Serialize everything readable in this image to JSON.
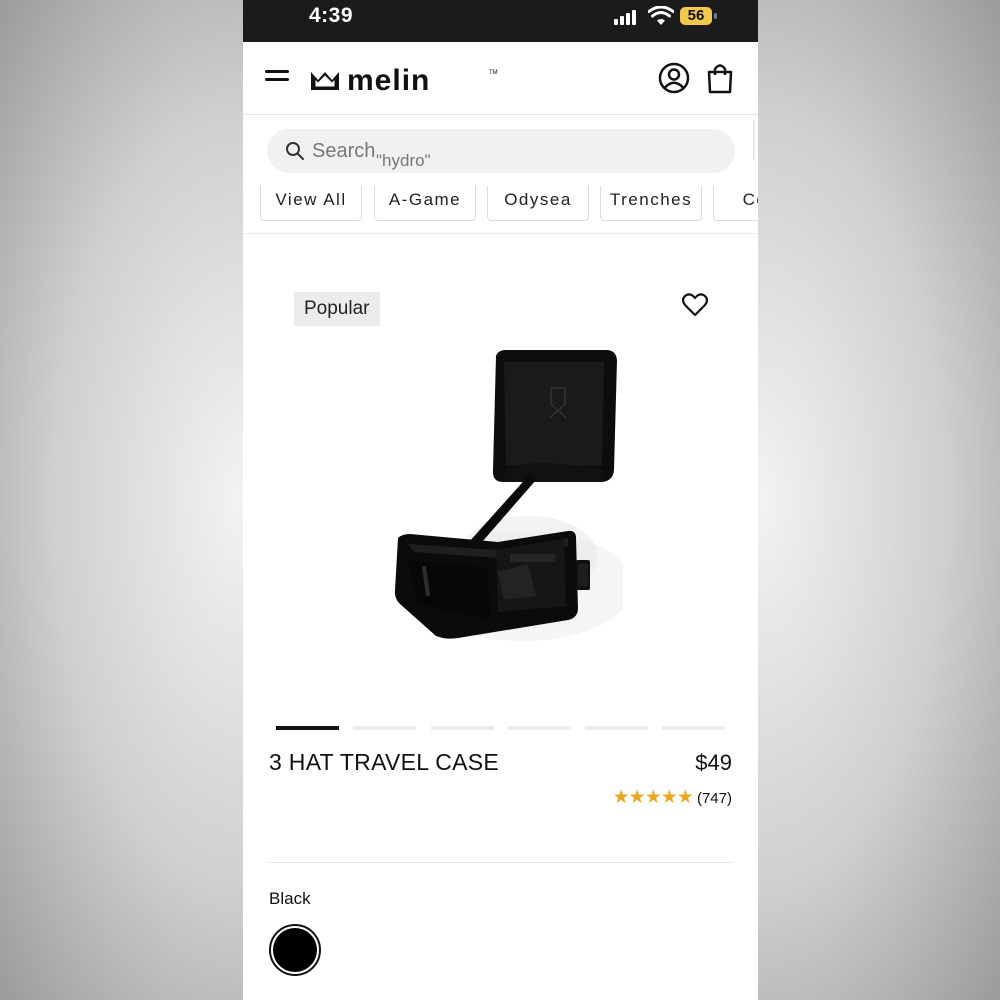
{
  "status_bar": {
    "time": "4:39",
    "battery": "56"
  },
  "header": {
    "brand": "melin"
  },
  "search": {
    "placeholder": "Search",
    "hint": "\"hydro\""
  },
  "categories": [
    "View All",
    "A-Game",
    "Odysea",
    "Trenches",
    "Cord"
  ],
  "product": {
    "badge": "Popular",
    "name": "3 HAT TRAVEL CASE",
    "price": "$49",
    "stars": "★★★★★",
    "rating": 5,
    "review_count": "(747)",
    "image_count": 6,
    "active_image": 1,
    "color_label": "Black",
    "swatch_color": "#000000"
  },
  "colors": {
    "accent_star": "#e8a923",
    "status_bar": "#1b1b1b",
    "battery": "#f2c94c"
  }
}
